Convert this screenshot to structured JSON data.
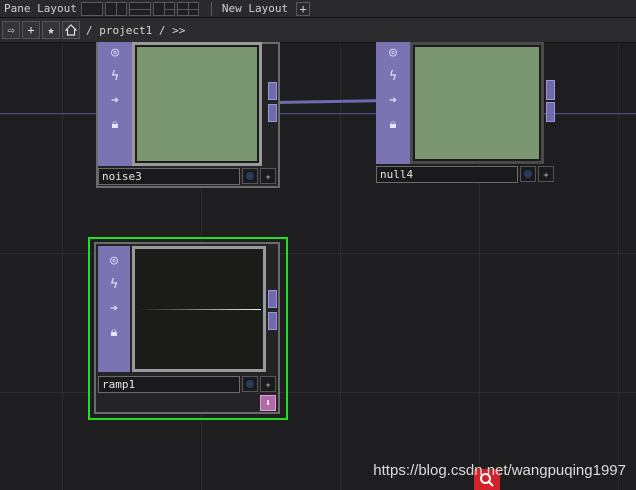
{
  "topbar": {
    "pane_layout_label": "Pane Layout",
    "new_layout_label": "New Layout",
    "add_label": "+"
  },
  "pathbar": {
    "path_text": "/ project1 / >>",
    "add_label": "+",
    "star_label": "★"
  },
  "nodes": {
    "noise3": {
      "name": "noise3",
      "viewer_color": "#7a9670"
    },
    "null4": {
      "name": "null4",
      "viewer_color": "#7a9670"
    },
    "ramp1": {
      "name": "ramp1",
      "viewer_color": "#1b1b18"
    }
  },
  "colors": {
    "selection": "#22dd22",
    "op_purple": "#7b74b3",
    "wire": "#6f6ab0"
  },
  "watermark": {
    "text": "https://blog.csdn.net/wangpuqing1997"
  },
  "icons": [
    "arrow-right-icon",
    "plus-icon",
    "star-icon",
    "home-icon",
    "target-icon",
    "lightning-icon",
    "arrow-icon",
    "lock-icon",
    "star-small-icon",
    "down-arrow-icon"
  ]
}
